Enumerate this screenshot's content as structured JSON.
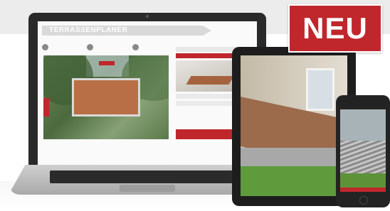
{
  "badge": {
    "label": "NEU"
  },
  "laptop": {
    "app_title": "TERRASSENPLANER"
  },
  "colors": {
    "brand_red": "#c0272d",
    "deck_brown": "#b86f45"
  }
}
